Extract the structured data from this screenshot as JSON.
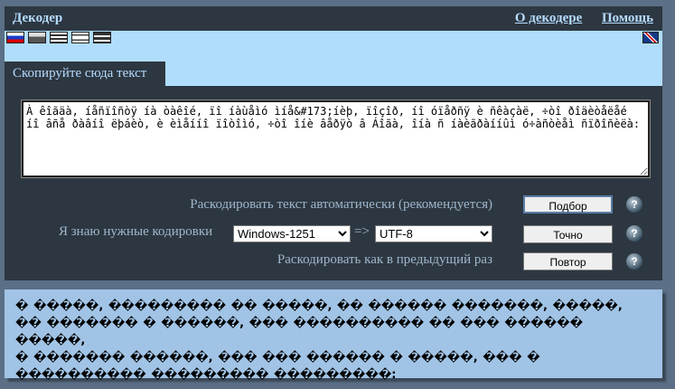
{
  "header": {
    "title": "Декодер",
    "links": [
      "О декодере",
      "Помощь"
    ]
  },
  "flags": [
    "russia-flag",
    "grey-flag",
    "greece-flag",
    "israel-flag",
    "striped-flag"
  ],
  "lang_flag": "uk-flag",
  "tab": "Скопируйте сюда текст",
  "input_text": "À êîãäà, íåñïîñòÿ íà òàêîé, ïî íàùåìó ìíå&#173;íèþ, ïîçîð, íî óïåðñÿ è ñêàçàë, ÷òî ðîäèòåëåé íî âñå ðàâíî ëþáèò, è èìåííî ïîòîìó, ÷òî îíè âåðÿò â Áîãà, îíà ñ íàèãðàííûì ó÷àñòèåì ñïðîñèëà:",
  "auto": {
    "label": "Раскодировать текст автоматически (рекомендуется)",
    "button": "Подбор"
  },
  "manual": {
    "label": "Я знаю нужные кодировки",
    "from": "Windows-1251",
    "arrow": "=>",
    "to": "UTF-8",
    "button": "Точно"
  },
  "repeat": {
    "label": "Раскодировать как в предыдущий раз",
    "button": "Повтор"
  },
  "help": "?",
  "output_lines": [
    "� �����, ��������� �� �����, �� ������ �������, �����,",
    "�� ������� � ������, ��� ���������� �� ��� ������ �����,",
    "� ������� ������, ��� ��� ������ � �����, ��� �",
    "���������� ��������� ���������:"
  ]
}
